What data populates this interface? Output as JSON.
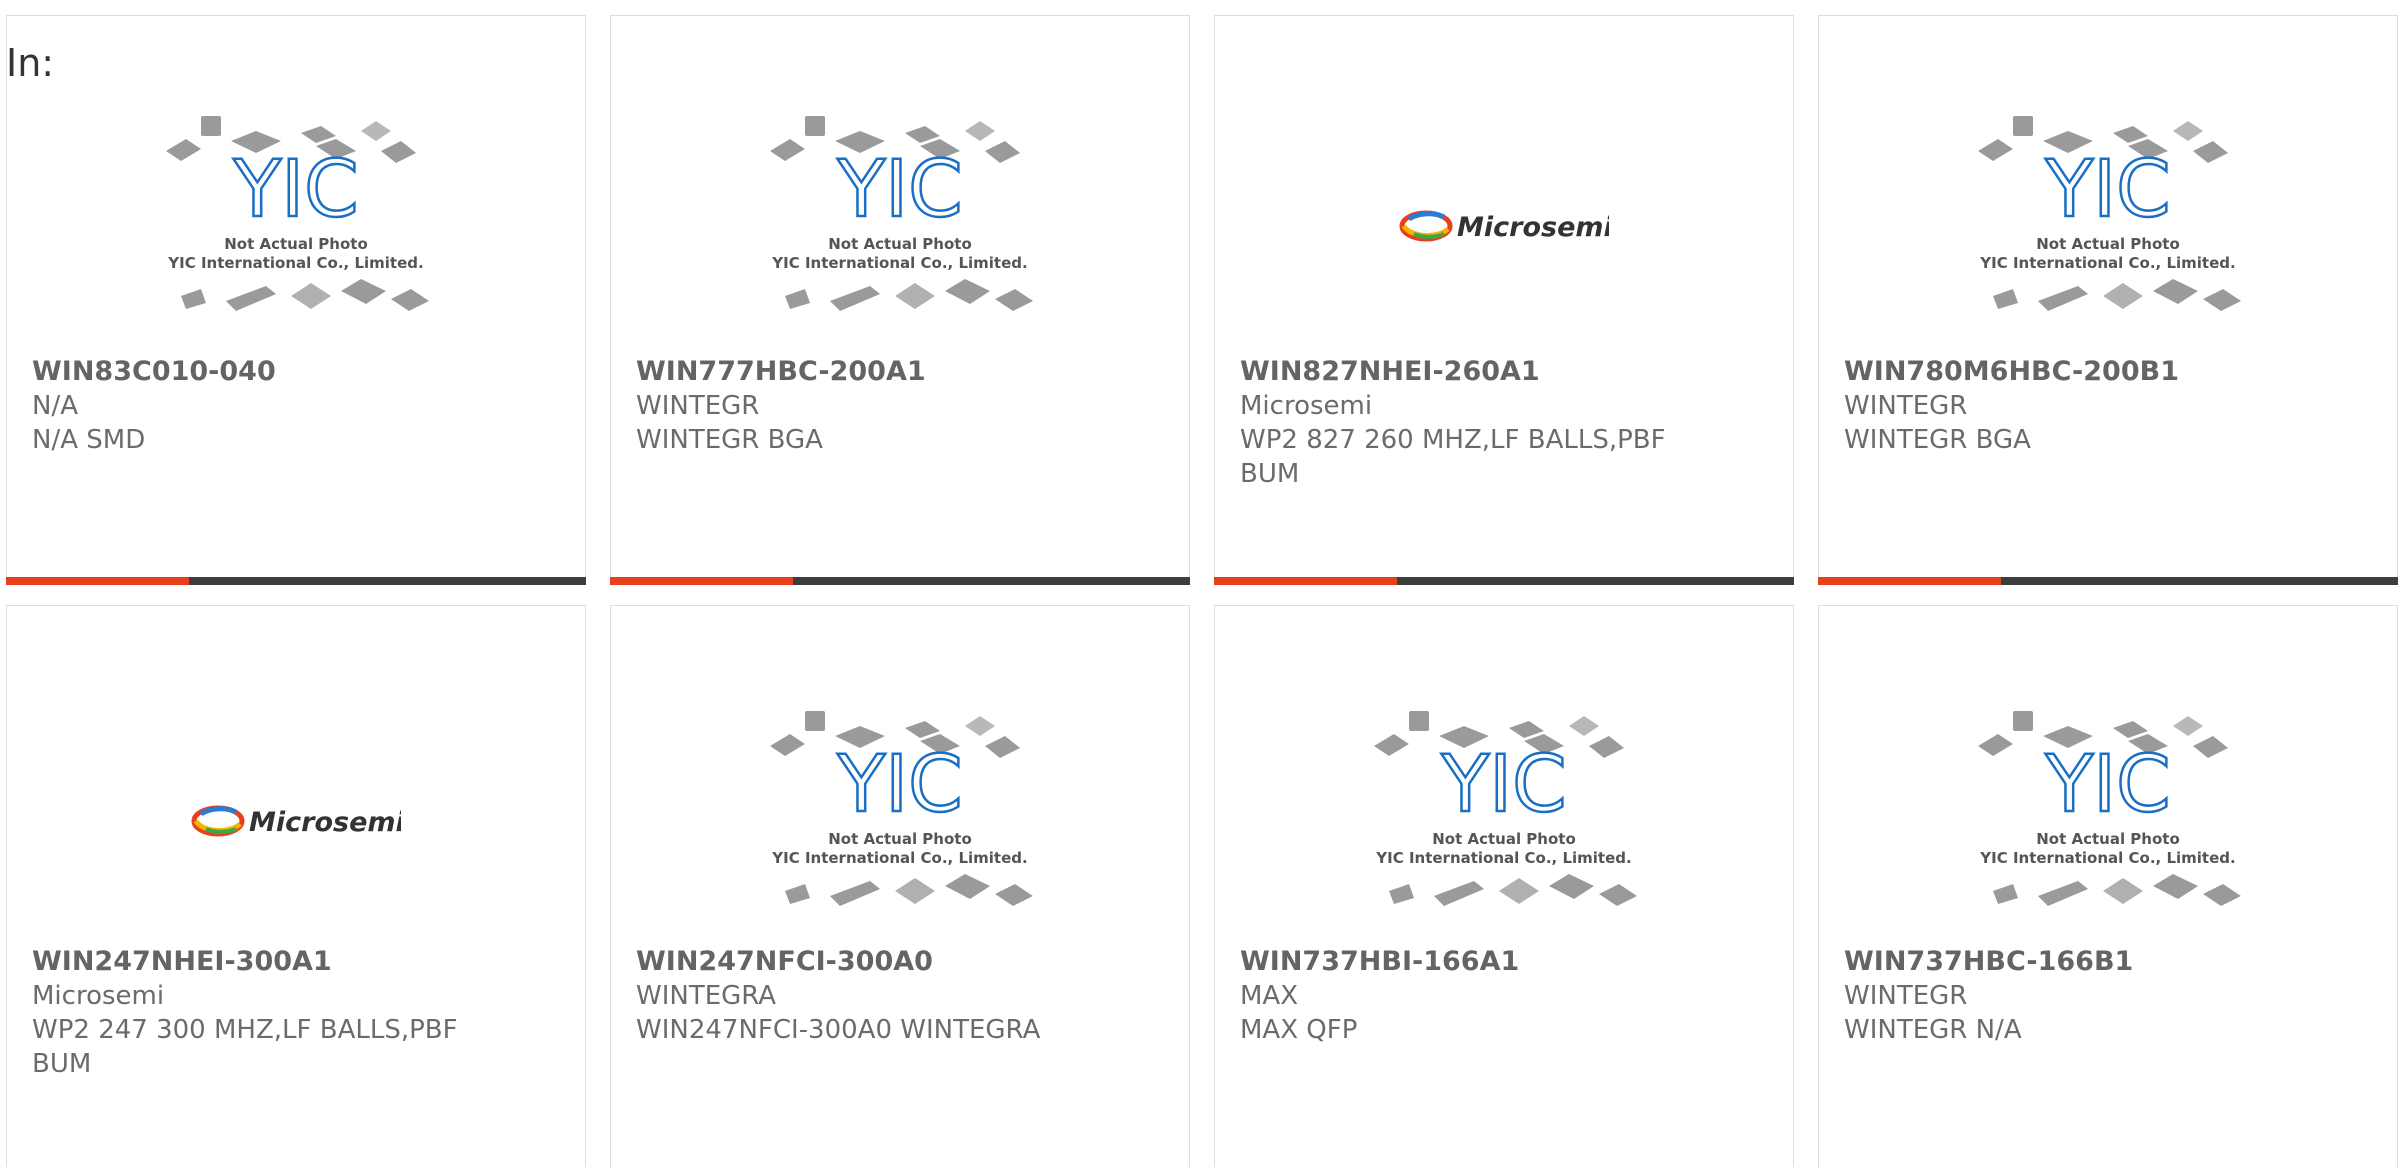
{
  "search": {
    "label": "In:"
  },
  "placeholder": {
    "logo": "YIC",
    "line1": "Not Actual Photo",
    "line2": "YIC International Co., Limited."
  },
  "brand_logo": {
    "text": "Microsemi"
  },
  "colors": {
    "accent": "#e8401c",
    "bar": "#3d3d3d",
    "yic_blue": "#1a6fc4"
  },
  "products": [
    {
      "part": "WIN83C010-040",
      "maker": "N/A",
      "desc": "N/A SMD",
      "image": "placeholder"
    },
    {
      "part": "WIN777HBC-200A1",
      "maker": "WINTEGR",
      "desc": "WINTEGR BGA",
      "image": "placeholder"
    },
    {
      "part": "WIN827NHEI-260A1",
      "maker": "Microsemi",
      "desc": "WP2 827 260 MHZ,LF BALLS,PBF BUM",
      "image": "brand"
    },
    {
      "part": "WIN780M6HBC-200B1",
      "maker": "WINTEGR",
      "desc": "WINTEGR BGA",
      "image": "placeholder"
    },
    {
      "part": "WIN247NHEI-300A1",
      "maker": "Microsemi",
      "desc": "WP2 247 300 MHZ,LF BALLS,PBF BUM",
      "image": "brand"
    },
    {
      "part": "WIN247NFCI-300A0",
      "maker": "WINTEGRA",
      "desc": "WIN247NFCI-300A0 WINTEGRA",
      "image": "placeholder"
    },
    {
      "part": "WIN737HBI-166A1",
      "maker": "MAX",
      "desc": "MAX QFP",
      "image": "placeholder"
    },
    {
      "part": "WIN737HBC-166B1",
      "maker": "WINTEGR",
      "desc": "WINTEGR N/A",
      "image": "placeholder"
    }
  ]
}
